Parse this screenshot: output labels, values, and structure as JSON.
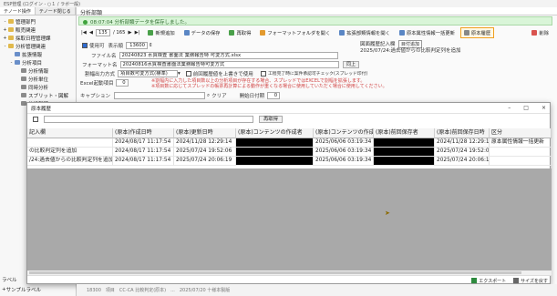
{
  "app_title": "ESP管理 (ログイン - ○１ / ラボ一般)",
  "left_panel": {
    "tabs": [
      "テノード操作",
      "テノード閉じる"
    ],
    "tree": [
      {
        "level": 1,
        "exp": "-",
        "label": "管理部門"
      },
      {
        "level": 1,
        "exp": "+",
        "label": "販売関連"
      },
      {
        "level": 1,
        "exp": "+",
        "label": "採取日程管理課"
      },
      {
        "level": 1,
        "exp": "-",
        "label": "分析管理関連"
      },
      {
        "level": 2,
        "exp": "",
        "label": "拡張情報"
      },
      {
        "level": 2,
        "exp": "-",
        "label": "分析項目"
      },
      {
        "level": 3,
        "exp": "",
        "label": "分析情報"
      },
      {
        "level": 3,
        "exp": "",
        "label": "分析単位"
      },
      {
        "level": 3,
        "exp": "",
        "label": "同時分析"
      },
      {
        "level": 3,
        "exp": "",
        "label": "スプリット・図解"
      },
      {
        "level": 3,
        "exp": "",
        "label": "分析部類"
      }
    ],
    "bottom_items": [
      "ラベル",
      "サンプルラベル"
    ]
  },
  "content": {
    "title": "分析部類",
    "info_message": "08:07:04 分析部類データを保存しました。",
    "toolbar": {
      "page_current": "135",
      "page_total": "/ 165",
      "buttons": [
        "新規追加",
        "データの保存",
        "再取得",
        "フォーマットフォルダを開く",
        "拡張部類情報を開く",
        "原本属性情報一括更新",
        "原本履歴",
        "削除"
      ],
      "tooltip": "目付追加"
    },
    "form": {
      "use_label": "使用可",
      "display_order_label": "表示順",
      "display_order_value": "13600",
      "file_name_label": "ファイル名",
      "file_name_value": "20240823 水質検査 書面法 業務報告特 可変方式.xlsx",
      "format_name_label": "フォーマット名",
      "format_name_value": "20240816水質検査書面法業務報告特可変方式",
      "numbering_label": "割幅出力方式",
      "numbering_value": "項目数可変方式(標準)",
      "prev_report_label": "前回履歴値を上書きで使用",
      "process_label": "工程完了時に案件承認可チェック(スプレッド印付)",
      "note_line1": "※割幅内に入力した項目数以上の分析項目が存在する場合、スプレッドではEXCELで割幅を拡張します。",
      "note_line2": "※項目数に応じてスプレッドの帳票再計算による動作が重くなる場合に使用していただく場合に使用してください。",
      "excel_label": "Excel起動項目",
      "excel_value": "0",
      "number_label": "番号",
      "number_value": "0",
      "caption_label": "キャプション",
      "clear_label": "クリア",
      "period_label": "開始日付期",
      "period_value": "0",
      "same_label": "同上"
    },
    "right_info": {
      "title": "図面履歴記入欄",
      "line": "2025/07/24:過去値からの比較判定列を追加"
    }
  },
  "popup": {
    "title": "原本履歴",
    "window_controls": {
      "minimize": "–",
      "maximize": "□",
      "close": "×"
    },
    "reload_label": "再取得",
    "columns": [
      "記入欄",
      "(原本)作成日時",
      "(原本)更新日時",
      "(原本)コンテンツの作成者",
      "(原本)コンテンツの作成日時",
      "(原本)前回保存者",
      "(原本)前回保存日時",
      "区分"
    ],
    "rows": [
      {
        "note": "",
        "created": "2024/08/17 11:17:54",
        "updated": "2024/11/28 12:29:14",
        "author": "",
        "content_created": "2025/06/06 03:19:34",
        "saved_by": "",
        "saved_at": "2024/11/28 12:29:14",
        "category": "原本属性情報一括更新"
      },
      {
        "note": "の比較判定列を追加",
        "created": "2024/08/17 11:17:54",
        "updated": "2025/07/24 19:52:06",
        "author": "",
        "content_created": "2025/06/06 03:19:34",
        "saved_by": "",
        "saved_at": "2025/07/24 19:52:06",
        "category": ""
      },
      {
        "note": "/24:過去値からの比較判定列を追加",
        "created": "2024/08/17 11:17:54",
        "updated": "2025/07/24 20:06:19",
        "author": "",
        "content_created": "2025/06/06 03:19:34",
        "saved_by": "",
        "saved_at": "2025/07/24 20:06:19",
        "category": ""
      }
    ],
    "footer": {
      "export_label": "エクスポート",
      "size_label": "サイズを戻す"
    }
  },
  "bottom_row_text": "18300　項目　CC-CA  比較判定(原本)　...　2025/07/20 十様本製版"
}
